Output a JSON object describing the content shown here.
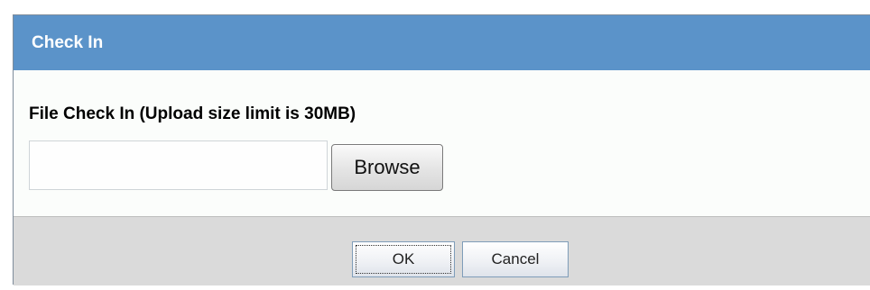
{
  "dialog": {
    "title": "Check In",
    "field_label": "File Check In (Upload size limit is 30MB)",
    "file_input": {
      "value": "",
      "placeholder": ""
    },
    "browse_label": "Browse",
    "ok_label": "OK",
    "cancel_label": "Cancel"
  },
  "colors": {
    "title_bar": "#5b93c9",
    "body_background": "#fbfdfb",
    "footer_background": "#dadada"
  }
}
